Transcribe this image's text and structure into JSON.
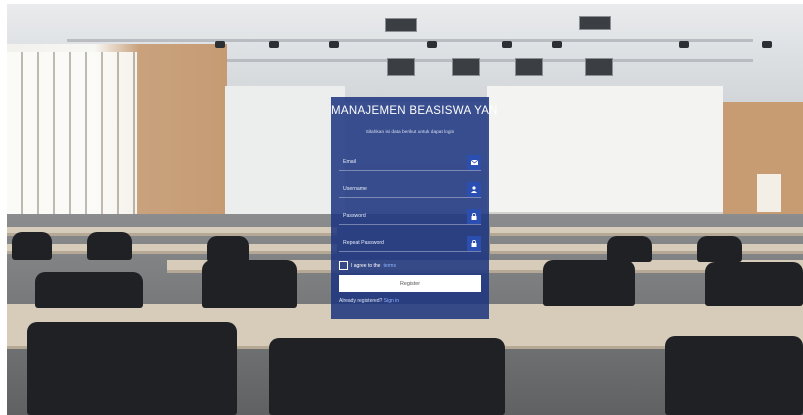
{
  "form": {
    "title": "MANAJEMEN BEASISWA YAN",
    "subtitle": "Silahkan isi data berikut untuk dapat login",
    "fields": [
      {
        "label": "Email",
        "icon": "envelope-icon"
      },
      {
        "label": "Username",
        "icon": "user-icon"
      },
      {
        "label": "Password",
        "icon": "lock-icon"
      },
      {
        "label": "Repeat Password",
        "icon": "lock-icon"
      }
    ],
    "terms_prefix": "I agree to the",
    "terms_link": "terms",
    "register_label": "Register",
    "already_text": "Already registered?",
    "signin_link": "Sign in"
  },
  "colors": {
    "panel": "#1c3480",
    "icon_box": "#2a4fb0",
    "link": "#8fb3ff"
  }
}
